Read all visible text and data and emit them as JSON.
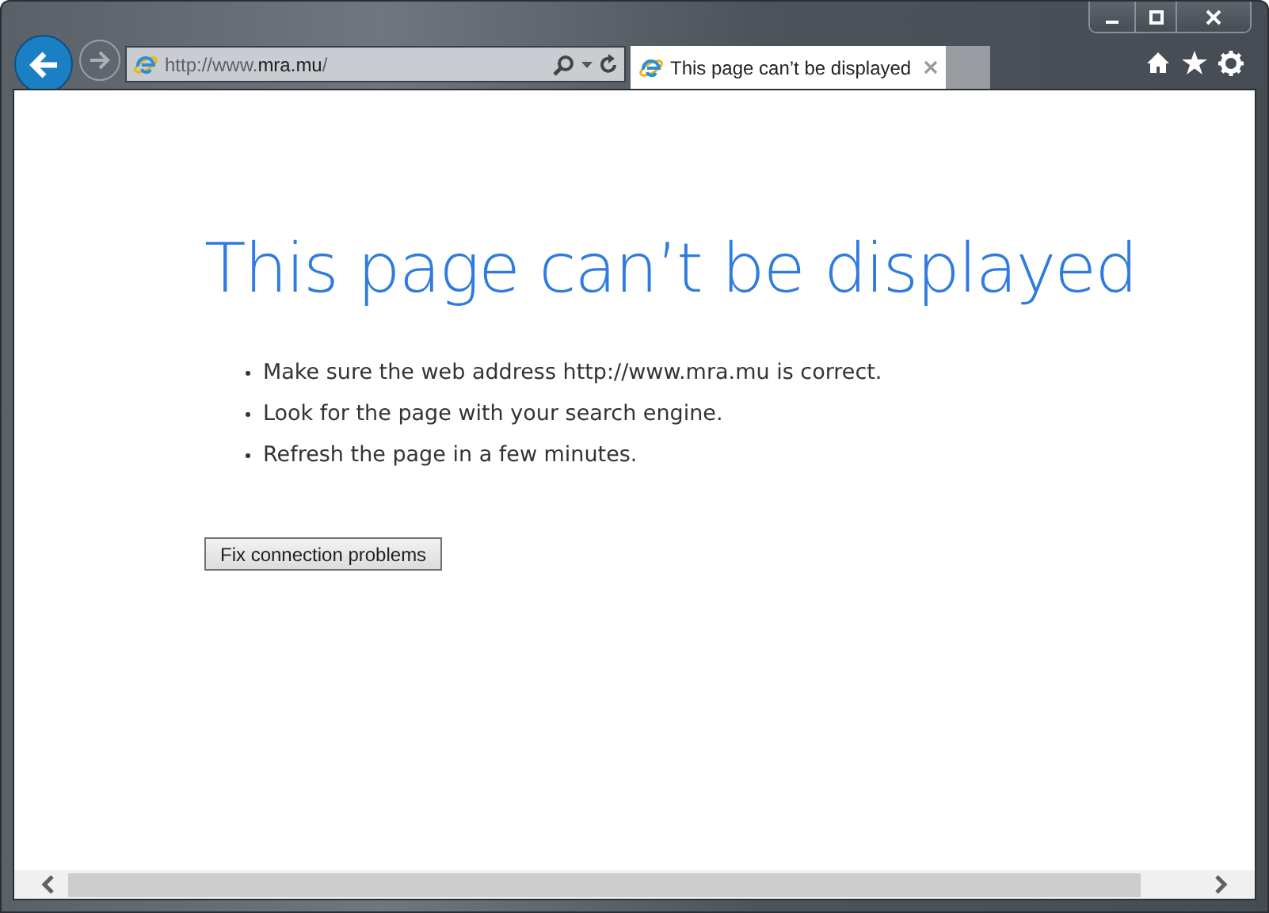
{
  "window": {
    "controls": [
      {
        "kind": "minimize"
      },
      {
        "kind": "maximize"
      },
      {
        "kind": "close"
      }
    ]
  },
  "address": {
    "prefix": "http://www.",
    "domain": "mra.mu",
    "suffix": "/"
  },
  "tabs": [
    {
      "label": "This page can’t be displayed",
      "selected": true
    }
  ],
  "page": {
    "heading": "This page can’t be displayed",
    "tips": [
      "Make sure the web address http://www.mra.mu is correct.",
      "Look for the page with your search engine.",
      "Refresh the page in a few minutes."
    ],
    "button": "Fix connection problems"
  }
}
